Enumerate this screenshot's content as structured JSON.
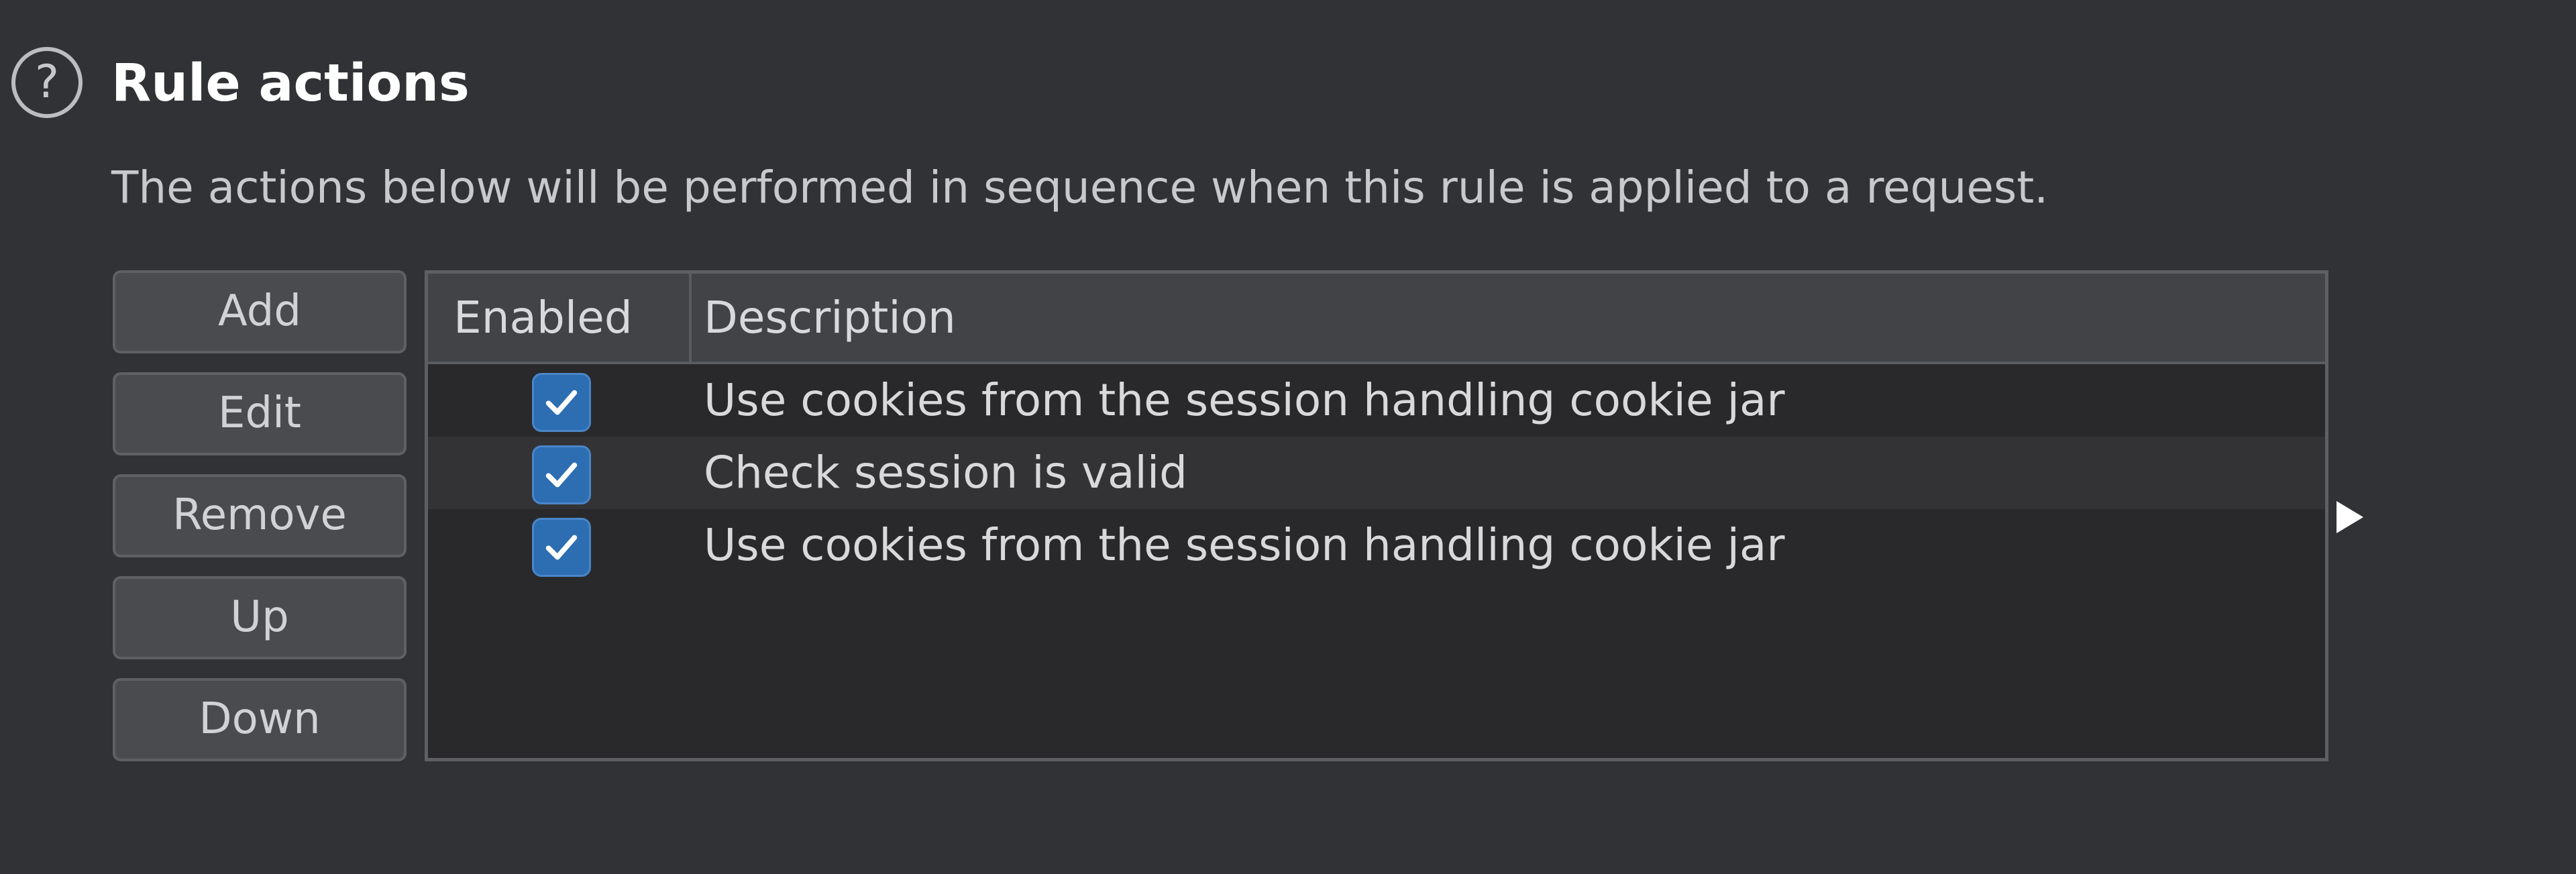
{
  "header": {
    "help_icon_glyph": "?",
    "title": "Rule actions",
    "subtitle": "The actions below will be performed in sequence when this rule is applied to a request."
  },
  "buttons": {
    "add": "Add",
    "edit": "Edit",
    "remove": "Remove",
    "up": "Up",
    "down": "Down"
  },
  "table": {
    "columns": [
      "Enabled",
      "Description"
    ],
    "rows": [
      {
        "enabled": true,
        "description": "Use cookies from the session handling cookie jar"
      },
      {
        "enabled": true,
        "description": "Check session is valid"
      },
      {
        "enabled": true,
        "description": "Use cookies from the session handling cookie jar"
      }
    ]
  },
  "icons": {
    "help": "question-circle-icon",
    "check": "checkmark-icon",
    "expand": "triangle-right-icon"
  },
  "colors": {
    "background": "#313235",
    "checkbox_accent": "#2d6db1"
  }
}
